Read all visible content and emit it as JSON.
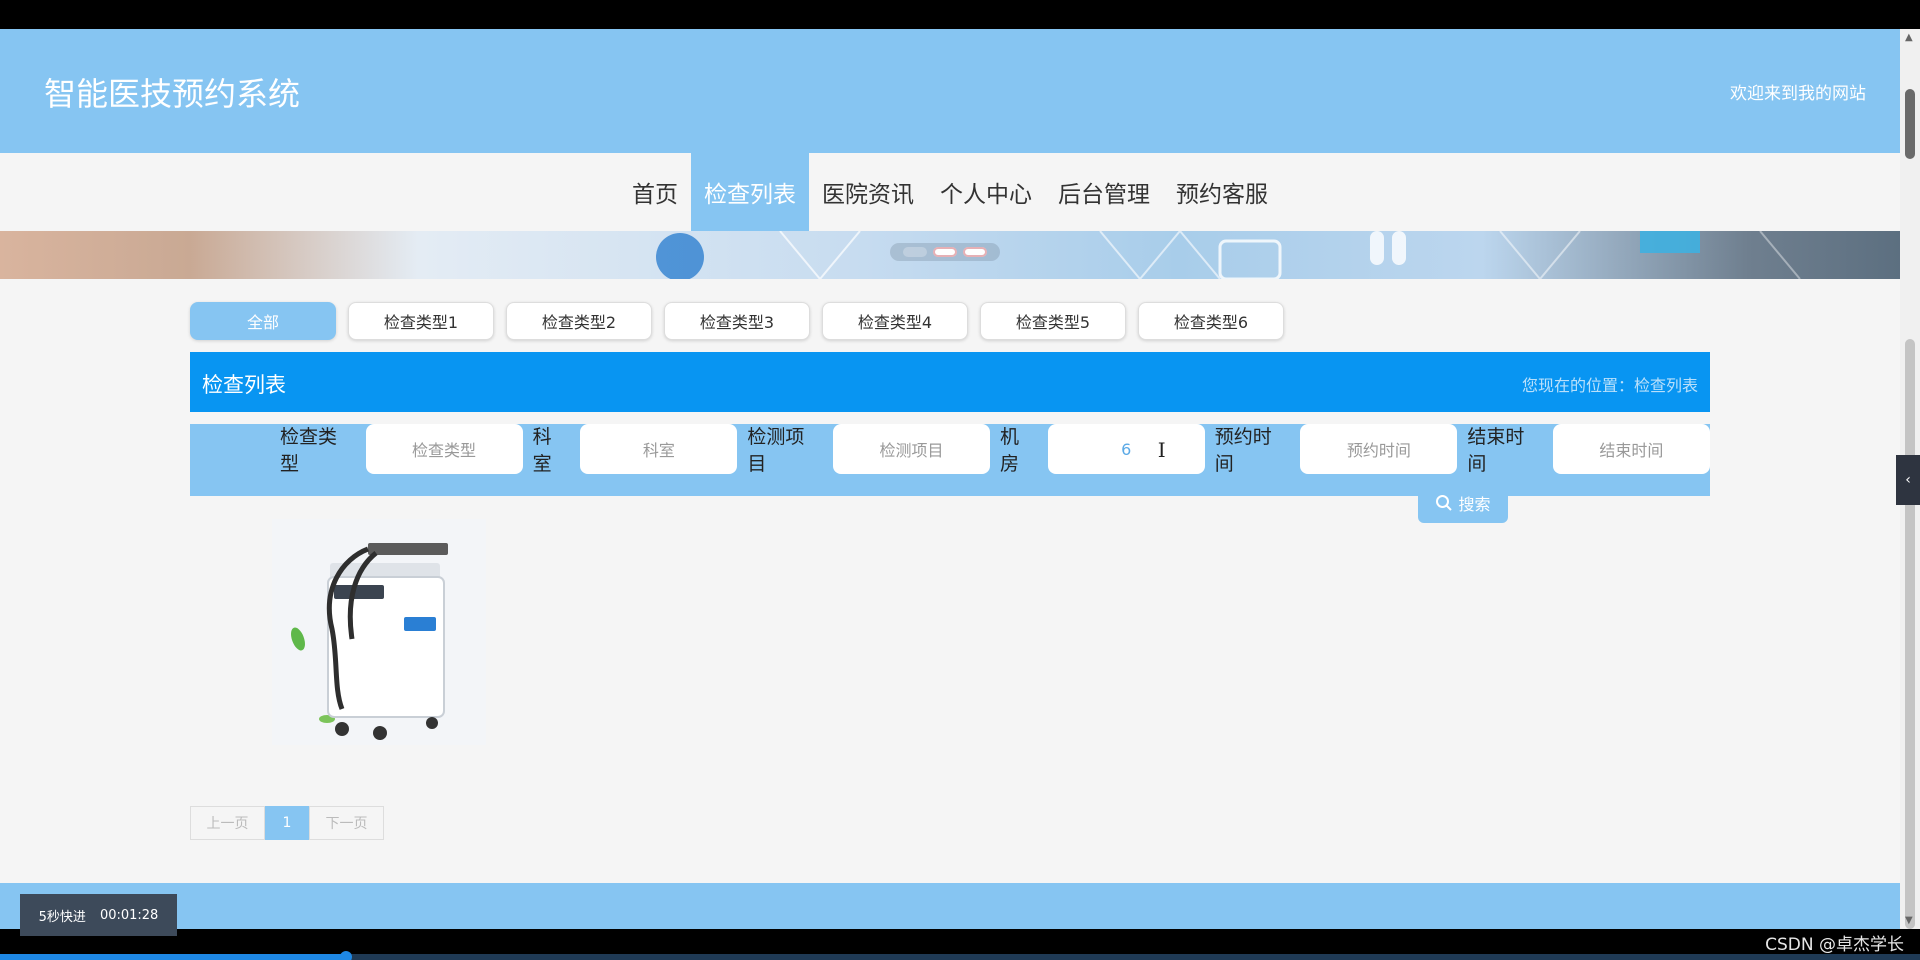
{
  "header": {
    "site_title": "智能医技预约系统",
    "welcome": "欢迎来到我的网站"
  },
  "nav": {
    "items": [
      {
        "label": "首页",
        "active": false
      },
      {
        "label": "检查列表",
        "active": true
      },
      {
        "label": "医院资讯",
        "active": false
      },
      {
        "label": "个人中心",
        "active": false
      },
      {
        "label": "后台管理",
        "active": false
      },
      {
        "label": "预约客服",
        "active": false
      }
    ]
  },
  "types": [
    {
      "label": "全部",
      "active": true
    },
    {
      "label": "检查类型1",
      "active": false
    },
    {
      "label": "检查类型2",
      "active": false
    },
    {
      "label": "检查类型3",
      "active": false
    },
    {
      "label": "检查类型4",
      "active": false
    },
    {
      "label": "检查类型5",
      "active": false
    },
    {
      "label": "检查类型6",
      "active": false
    }
  ],
  "list": {
    "title": "检查列表",
    "location": "您现在的位置：检查列表"
  },
  "search": {
    "fields": [
      {
        "label": "检查类型",
        "placeholder": "检查类型",
        "value": ""
      },
      {
        "label": "科室",
        "placeholder": "科室",
        "value": ""
      },
      {
        "label": "检测项目",
        "placeholder": "检测项目",
        "value": ""
      },
      {
        "label": "机房",
        "placeholder": "机房",
        "value": "6"
      },
      {
        "label": "预约时间",
        "placeholder": "预约时间",
        "value": ""
      },
      {
        "label": "结束时间",
        "placeholder": "结束时间",
        "value": ""
      }
    ],
    "button_label": "搜索"
  },
  "pagination": {
    "prev": "上一页",
    "current": "1",
    "next": "下一页"
  },
  "video": {
    "skip_label": "5秒快进",
    "time": "00:01:28",
    "progress_fraction": 0.18
  },
  "watermark": "CSDN @卓杰学长",
  "colors": {
    "primary_light": "#86c5f2",
    "primary_dark": "#0895f2"
  }
}
